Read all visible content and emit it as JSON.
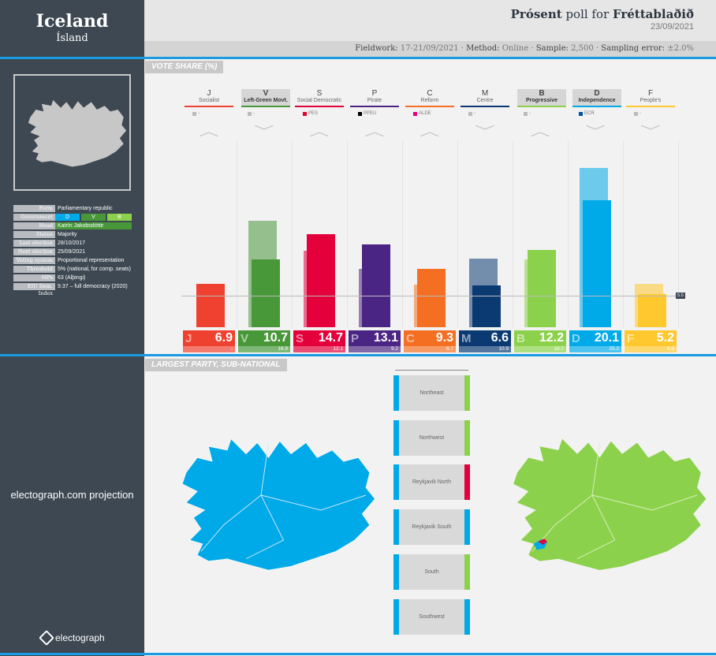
{
  "sidebar": {
    "country": "Iceland",
    "country_local": "Ísland",
    "info": [
      {
        "k": "Form",
        "v": "Parliamentary republic"
      },
      {
        "k": "Government",
        "v": [
          "D",
          "V",
          "B"
        ]
      },
      {
        "k": "Head",
        "v": "Katrín Jakobsdóttir"
      },
      {
        "k": "Status",
        "v": "Majority"
      },
      {
        "k": "Last election",
        "v": "28/10/2017"
      },
      {
        "k": "Next election",
        "v": "25/09/2021"
      },
      {
        "k": "Voting system",
        "v": "Proportional representation"
      },
      {
        "k": "Threshold",
        "v": "5% (national, for comp. seats)"
      },
      {
        "k": "MPs",
        "v": "63 (Alþingi)"
      },
      {
        "k": "EIU Dem. Index",
        "v": "9.37 – full democracy (2020)"
      }
    ],
    "projection": "electograph.com projection",
    "logo": "electograph"
  },
  "header": {
    "pollster": "Prósent",
    "poll_for": "poll for",
    "client": "Fréttablaðið",
    "date": "23/09/2021",
    "fieldwork_label": "Fieldwork:",
    "fieldwork": "17-21/09/2021",
    "method_label": "Method:",
    "method": "Online",
    "sample_label": "Sample:",
    "sample": "2,500",
    "error_label": "Sampling error:",
    "error": "±2.0%"
  },
  "sections": {
    "vote_share": "VOTE SHARE (%)",
    "subnational": "LARGEST PARTY, SUB-NATIONAL"
  },
  "chart_data": {
    "type": "bar",
    "ylabel": "",
    "threshold": 5.0,
    "threshold_label": "5.0",
    "parties": [
      {
        "code": "J",
        "name": "Socialist",
        "group": "-",
        "group_color": "#bbbbbb",
        "color": "#ef4130",
        "value": 6.9,
        "previous": null,
        "previous_label": "-",
        "trend": "up",
        "government": false
      },
      {
        "code": "V",
        "name": "Left-Green Movt.",
        "group": "-",
        "group_color": "#bbbbbb",
        "color": "#48983a",
        "value": 10.7,
        "previous": 16.9,
        "previous_label": "16.9",
        "trend": "down",
        "government": true
      },
      {
        "code": "S",
        "name": "Social Democratic",
        "group": "PES",
        "group_color": "#e4002b",
        "color": "#e4003a",
        "value": 14.7,
        "previous": 12.1,
        "previous_label": "12.1",
        "trend": "up",
        "government": false
      },
      {
        "code": "P",
        "name": "Pirate",
        "group": "PPEU",
        "group_color": "#000000",
        "color": "#4b2583",
        "value": 13.1,
        "previous": 9.2,
        "previous_label": "9.2",
        "trend": "up",
        "government": false
      },
      {
        "code": "C",
        "name": "Reform",
        "group": "ALDE",
        "group_color": "#e6007e",
        "color": "#f46f22",
        "value": 9.3,
        "previous": 6.7,
        "previous_label": "6.7",
        "trend": "up",
        "government": false
      },
      {
        "code": "M",
        "name": "Centre",
        "group": "-",
        "group_color": "#bbbbbb",
        "color": "#0b3a73",
        "value": 6.6,
        "previous": 10.9,
        "previous_label": "10.9",
        "trend": "down",
        "government": false
      },
      {
        "code": "B",
        "name": "Progressive",
        "group": "-",
        "group_color": "#bbbbbb",
        "color": "#8cd14b",
        "value": 12.2,
        "previous": 10.7,
        "previous_label": "10.7",
        "trend": "up",
        "government": true
      },
      {
        "code": "D",
        "name": "Independence",
        "group": "ECR",
        "group_color": "#0054a5",
        "color": "#00a9e8",
        "value": 20.1,
        "previous": 25.2,
        "previous_label": "25.2",
        "trend": "down",
        "government": true
      },
      {
        "code": "F",
        "name": "People's",
        "group": "-",
        "group_color": "#bbbbbb",
        "color": "#ffc82e",
        "value": 5.2,
        "previous": 6.9,
        "previous_label": "6.9",
        "trend": "down",
        "government": false
      }
    ]
  },
  "districts": [
    {
      "name": "Northeast",
      "now": "#00a9e8",
      "proj": "#8cd14b"
    },
    {
      "name": "Northwest",
      "now": "#00a9e8",
      "proj": "#8cd14b"
    },
    {
      "name": "Reykjavik North",
      "now": "#00a9e8",
      "proj": "#e4003a"
    },
    {
      "name": "Reykjavik South",
      "now": "#00a9e8",
      "proj": "#00a9e8"
    },
    {
      "name": "South",
      "now": "#00a9e8",
      "proj": "#8cd14b"
    },
    {
      "name": "Southwest",
      "now": "#00a9e8",
      "proj": "#00a9e8"
    }
  ],
  "colors": {
    "accent": "#1a9ae0",
    "sidebar": "#3d4852"
  }
}
